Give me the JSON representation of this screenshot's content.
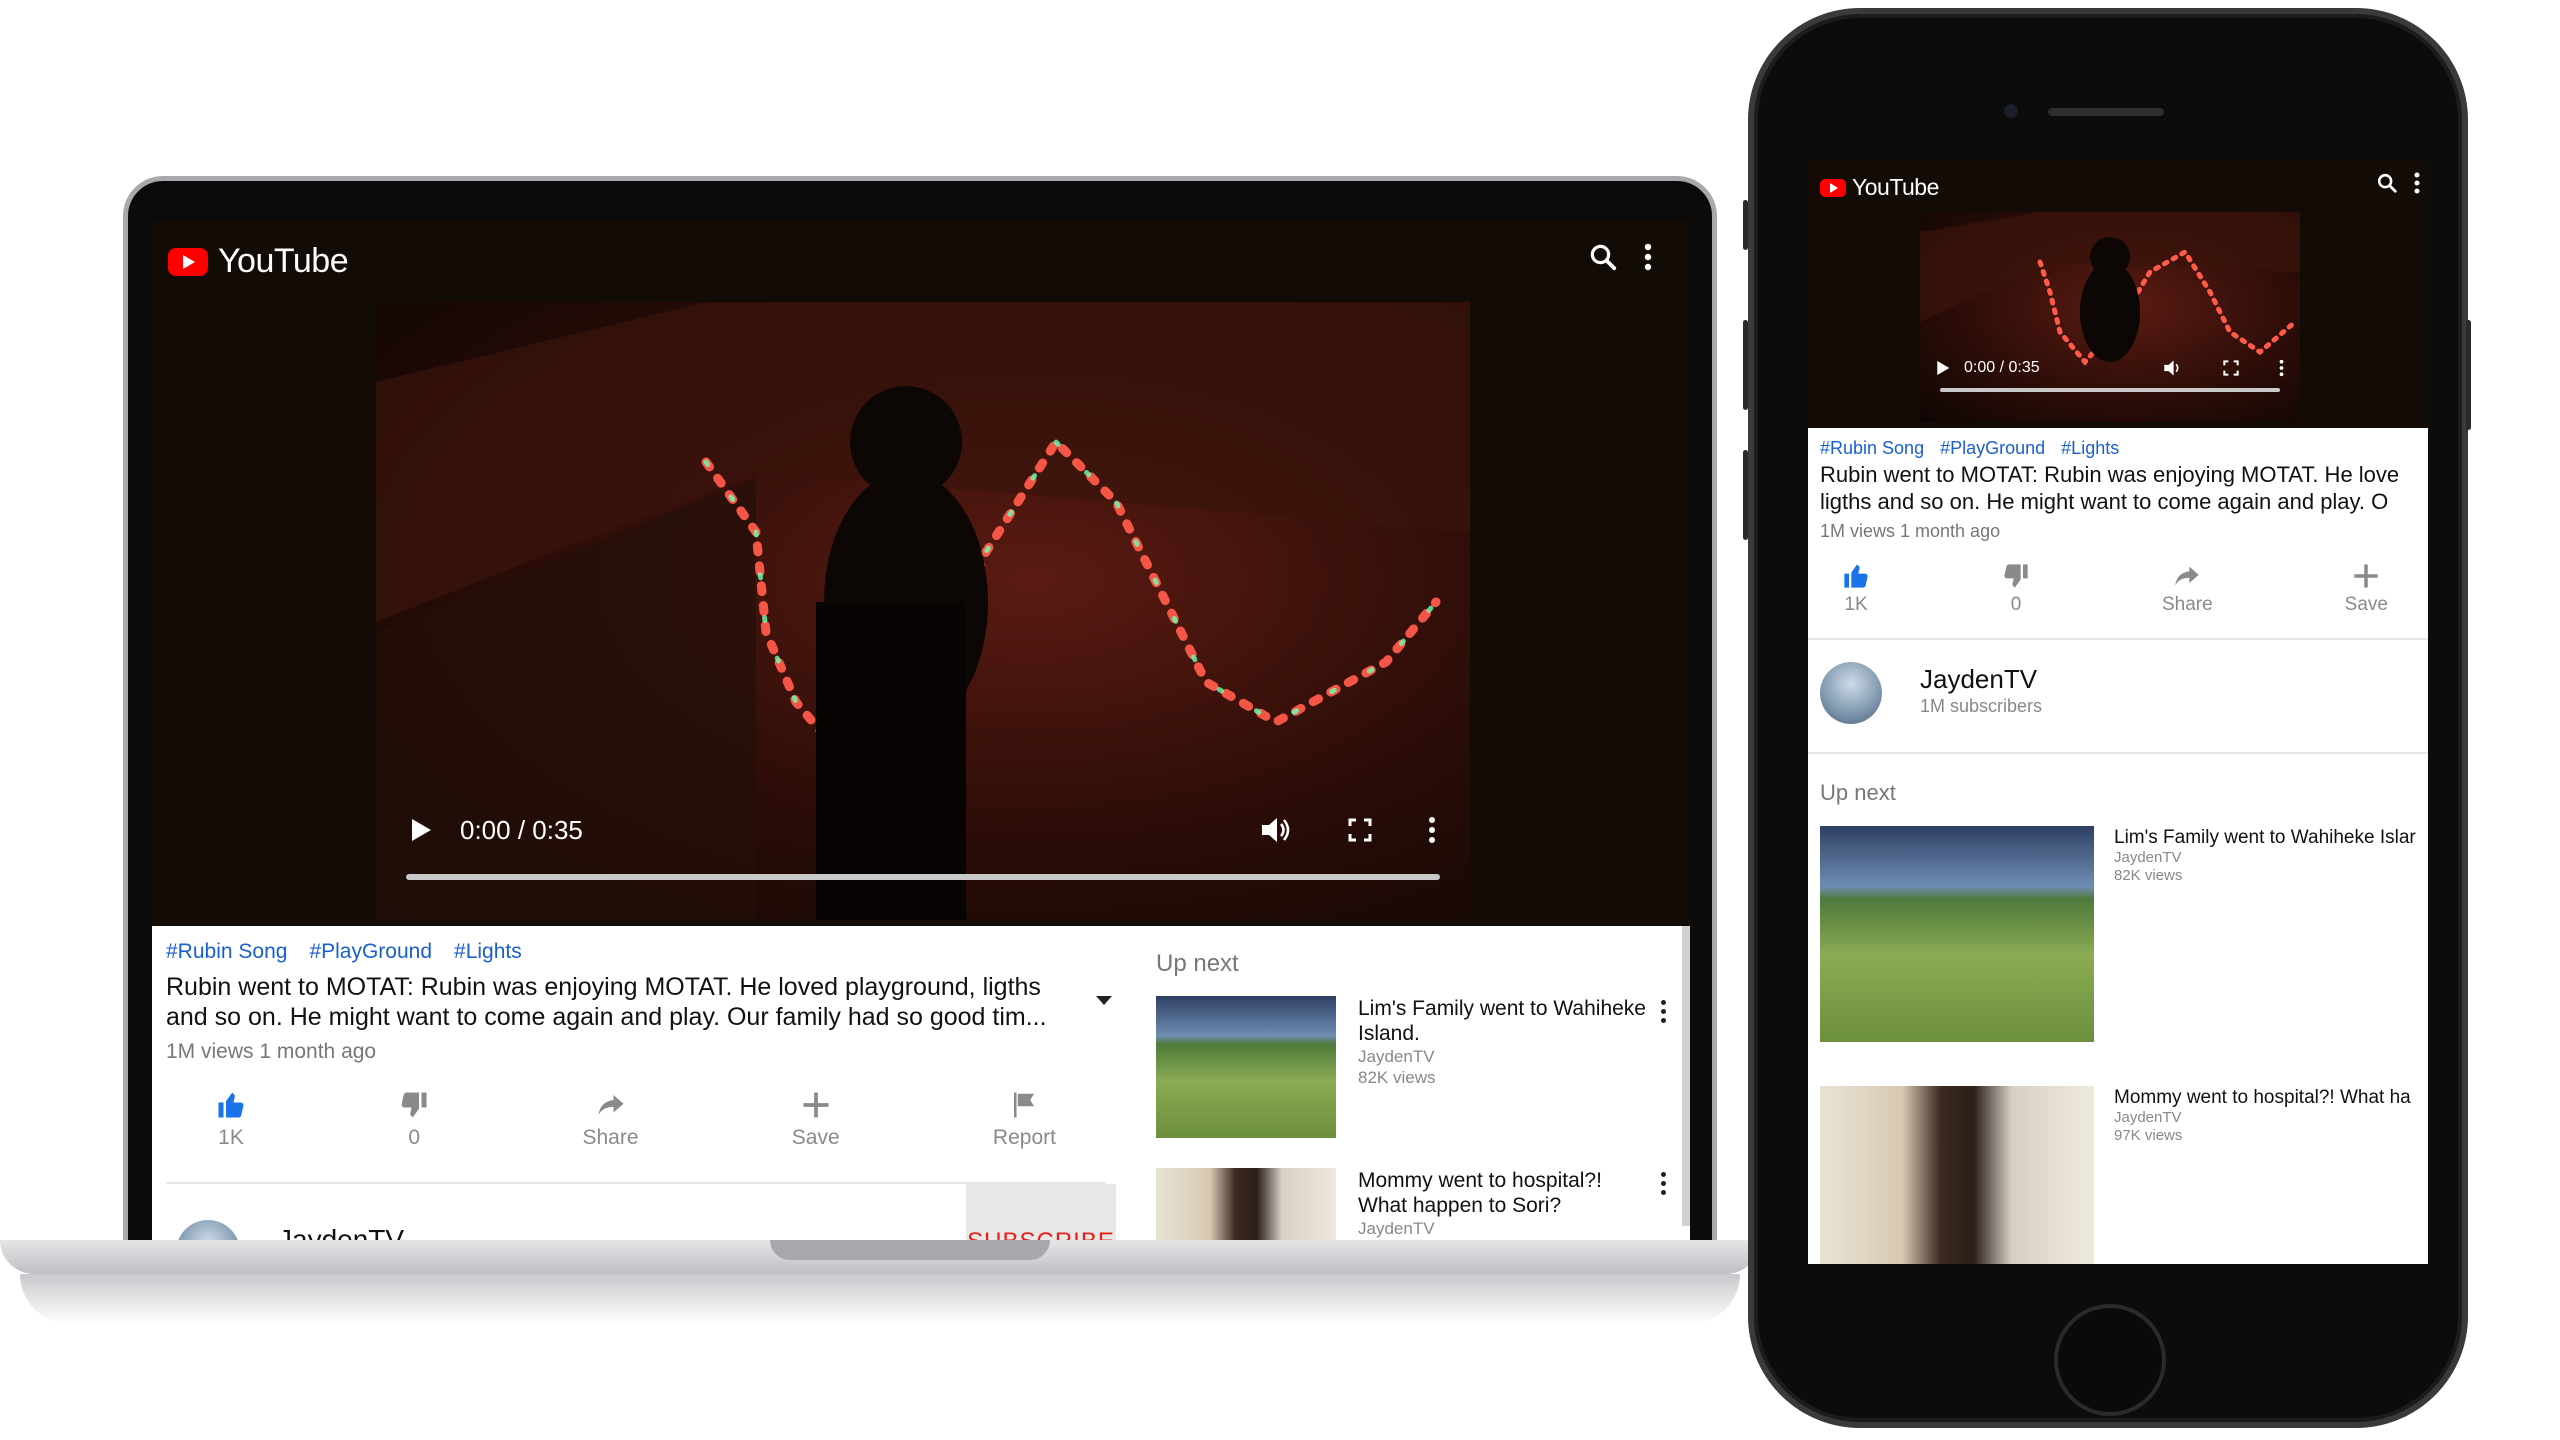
{
  "app": {
    "logo_text": "YouTube"
  },
  "colors": {
    "brand": "#ff0000",
    "tag": "#1a5fd0",
    "subscribe": "#e62117",
    "player_bg": "#130b05"
  },
  "player": {
    "time": "0:00 / 0:35"
  },
  "video": {
    "tags": [
      "#Rubin Song",
      "#PlayGround",
      "#Lights"
    ],
    "description_laptop": "Rubin went to MOTAT: Rubin was enjoying MOTAT. He loved playground, ligths and so on. He might want to come again and play. Our family had so good tim...",
    "description_phone_line1": "Rubin went to MOTAT: Rubin was enjoying MOTAT. He love",
    "description_phone_line2": "ligths and so on. He might want to come again and play. O",
    "meta": "1M views 1 month ago"
  },
  "actions": {
    "like": "1K",
    "dislike": "0",
    "share": "Share",
    "save": "Save",
    "report": "Report"
  },
  "channel": {
    "name": "JaydenTV",
    "subscribers": "1M subscribers",
    "subscribe_label": "SUBSCRIBE"
  },
  "up_next": {
    "title": "Up next",
    "items": [
      {
        "title_laptop": "Lim's Family went to Wahiheke Island.",
        "title_phone": "Lim's Family went to Wahiheke Islar",
        "channel": "JaydenTV",
        "views": "82K views"
      },
      {
        "title_laptop": "Mommy went to hospital?! What happen to Sori?",
        "title_phone": "Mommy went to hospital?! What ha",
        "channel": "JaydenTV",
        "views": "97K views"
      }
    ]
  },
  "icons": [
    "youtube-logo-icon",
    "search-icon",
    "more-vert-icon",
    "play-icon",
    "volume-icon",
    "fullscreen-icon",
    "thumbs-up-icon",
    "thumbs-down-icon",
    "share-icon",
    "plus-icon",
    "flag-icon",
    "dropdown-caret-icon"
  ]
}
